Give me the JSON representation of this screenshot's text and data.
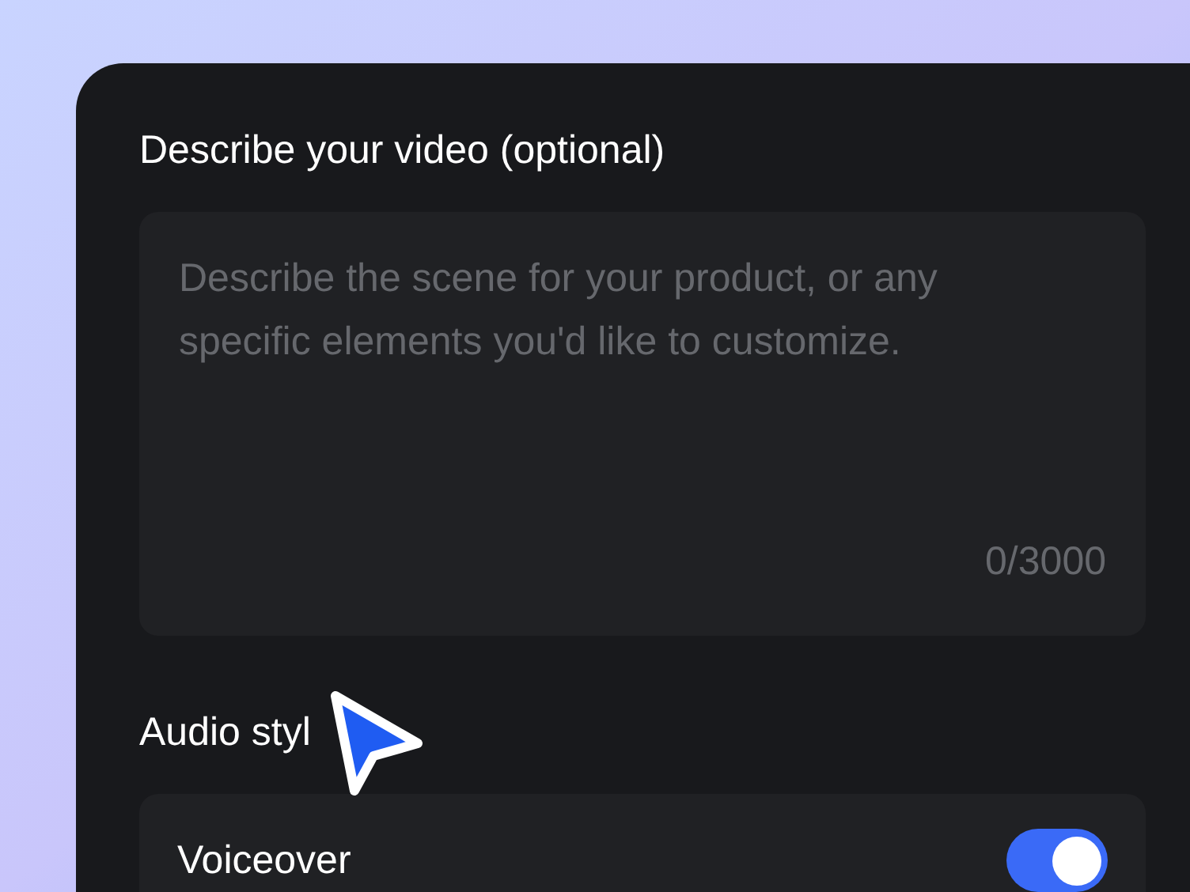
{
  "description": {
    "label": "Describe your video (optional)",
    "placeholder": "Describe the scene for your product, or any specific elements you'd like to customize.",
    "counter": "0/3000"
  },
  "audio": {
    "label": "Audio styl",
    "options": [
      {
        "label": "Voiceover",
        "on": true
      }
    ]
  }
}
